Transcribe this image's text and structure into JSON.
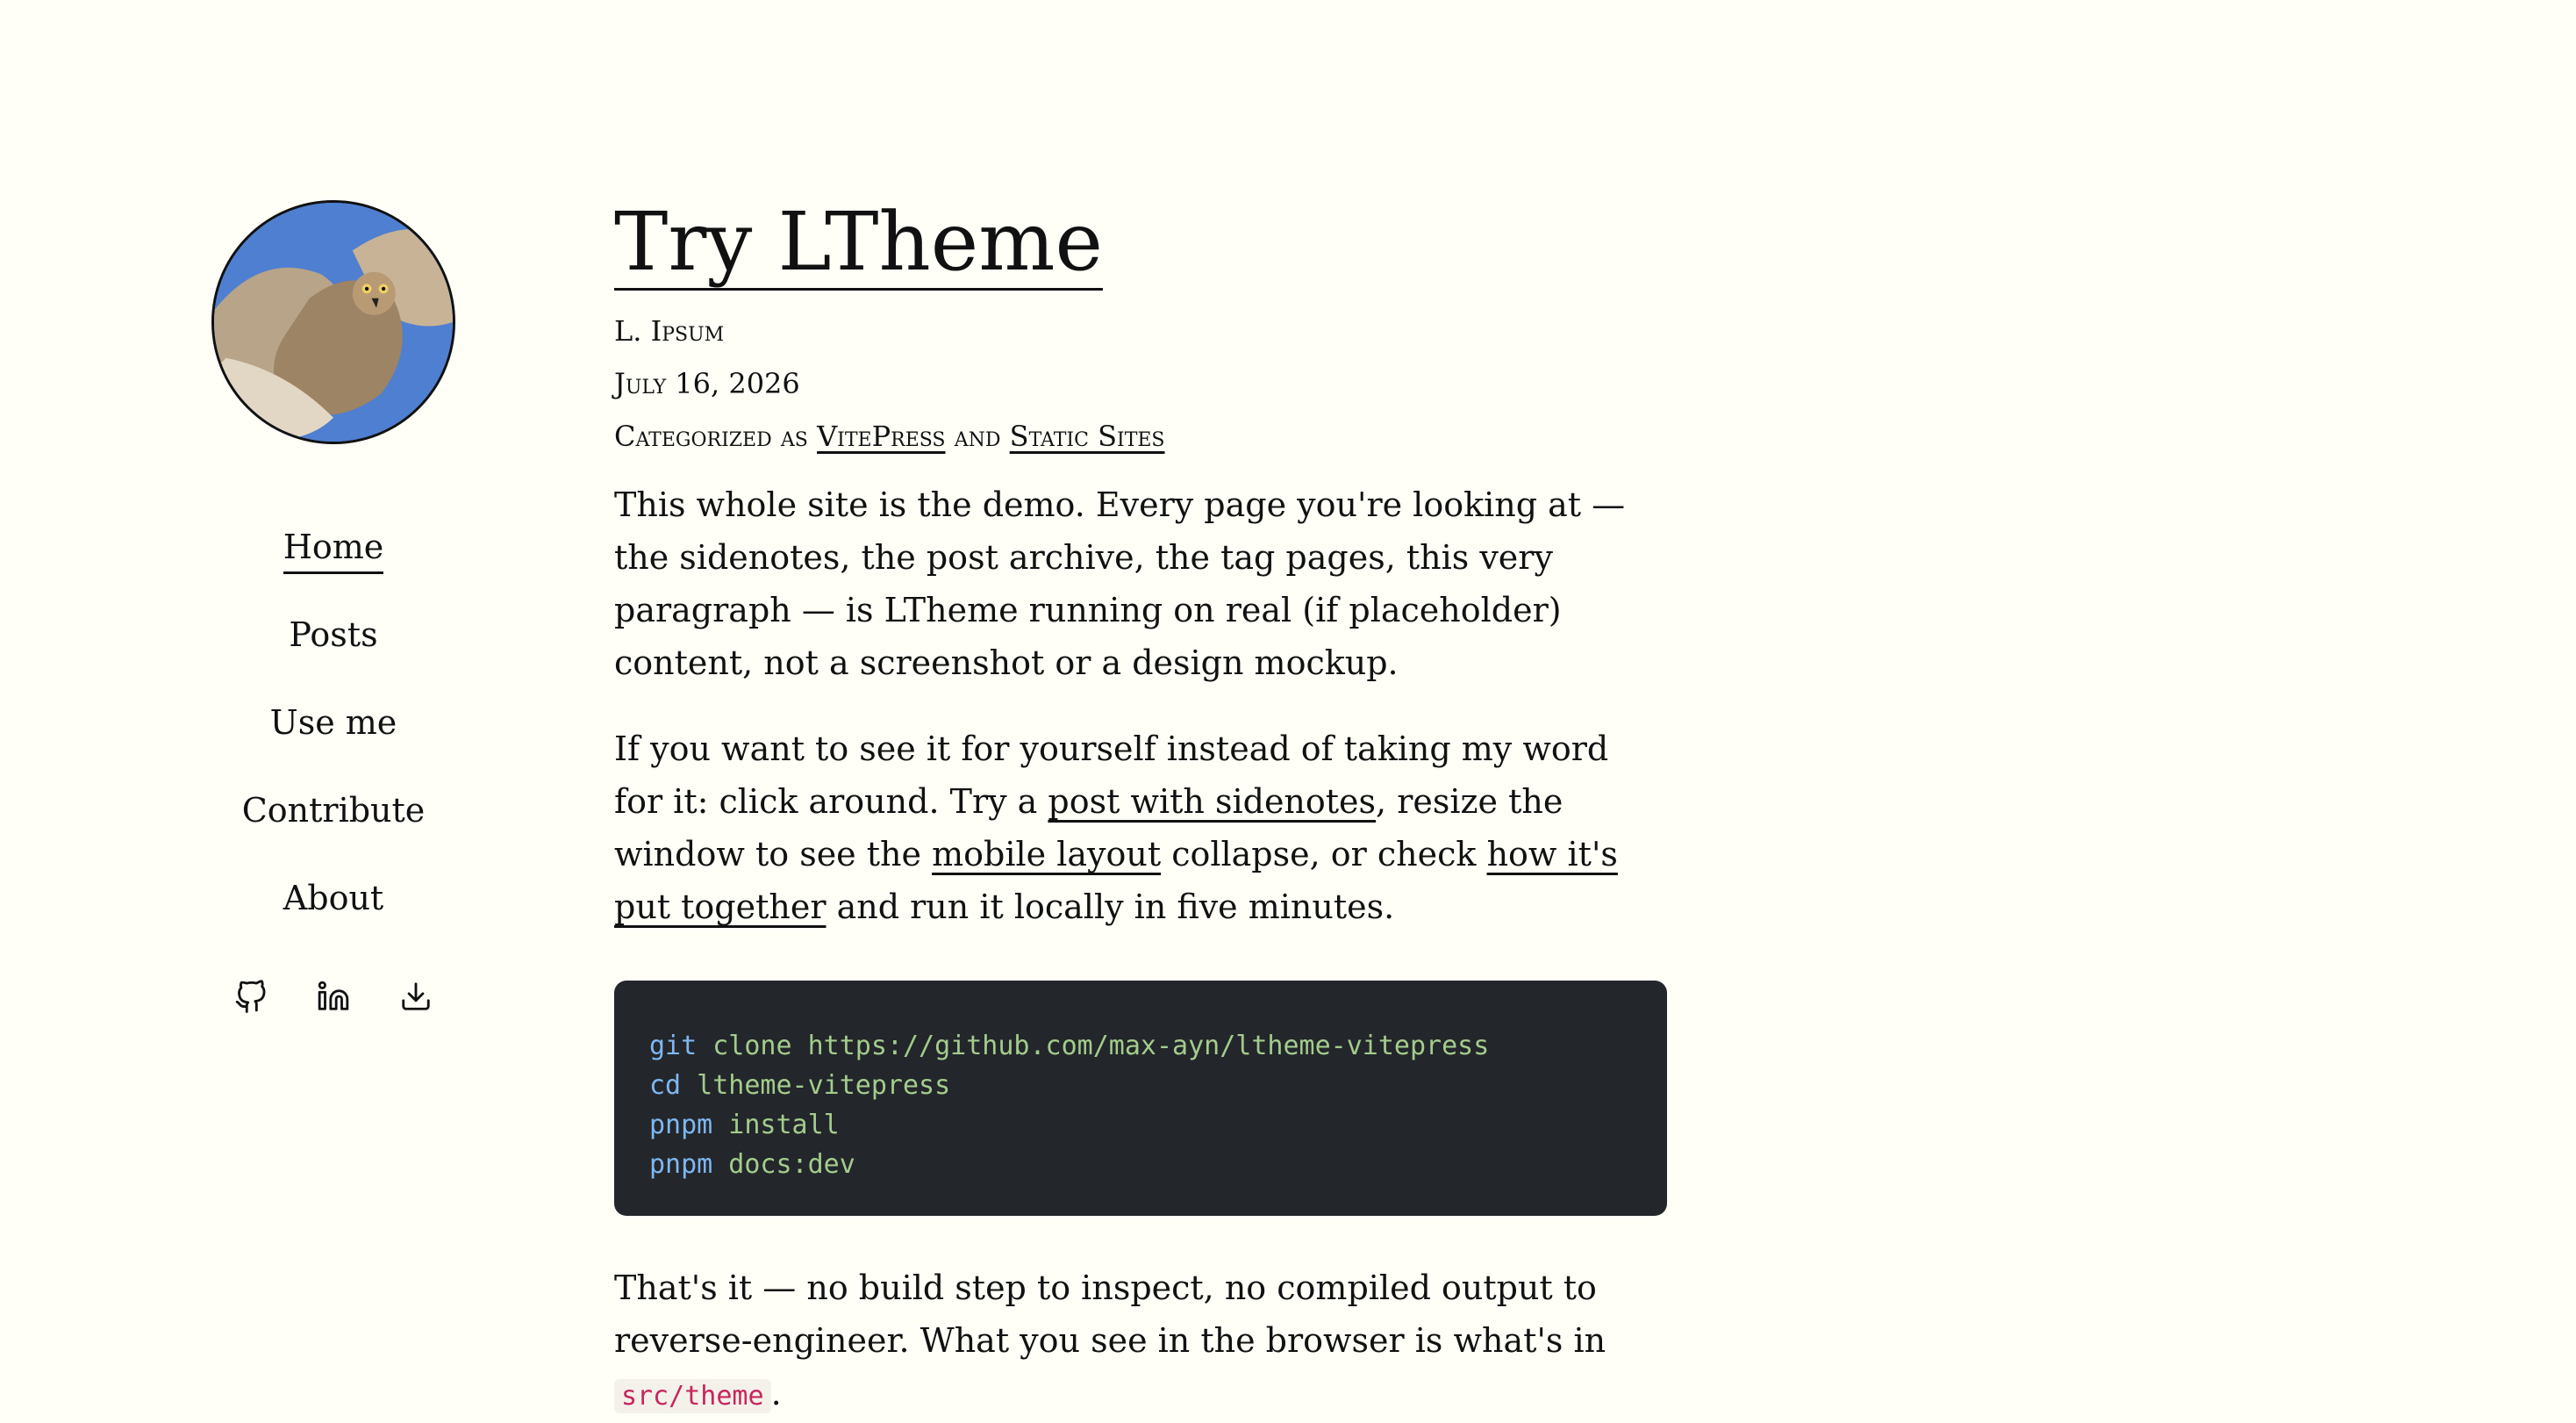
{
  "sidebar": {
    "nav": [
      "Home",
      "Posts",
      "Use me",
      "Contribute",
      "About"
    ],
    "social_icons": [
      "github-icon",
      "linkedin-icon",
      "download-icon"
    ]
  },
  "post": {
    "title": "Try LTheme",
    "author": "L. Ipsum",
    "date": "July 16, 2026",
    "categorized_as": "Categorized as",
    "and": "and",
    "tags": [
      "VitePress",
      "Static Sites"
    ],
    "p1": "This whole site is the demo. Every page you're looking at — the sidenotes, the post archive, the tag pages, this very paragraph — is LTheme running on real (if placeholder) content, not a screenshot or a design mockup.",
    "p2_a": "If you want to see it for yourself instead of taking my word for it: click around. Try a",
    "p2_link1": "post with sidenotes",
    "p2_b": ", resize the window to see the",
    "p2_link2": "mobile layout",
    "p2_c": "collapse, or check",
    "p2_link3": "how it's put together",
    "p2_d": "and run it locally in five minutes.",
    "code": [
      {
        "cmd": "git",
        "args": " clone https://github.com/max-ayn/ltheme-vitepress"
      },
      {
        "cmd": "cd",
        "args": " ltheme-vitepress"
      },
      {
        "cmd": "pnpm",
        "args": " install"
      },
      {
        "cmd": "pnpm",
        "args": " docs:dev"
      }
    ],
    "p3_a": "That's it — no build step to inspect, no compiled output to reverse-engineer. What you see in the browser is what's in",
    "p3_code": "src/theme",
    "p3_b": "."
  },
  "colors": {
    "background": "#fffff8",
    "code_bg": "#23262b",
    "code_cmd": "#7fb7f0",
    "code_arg": "#a3cc8c",
    "inline_code": "#c8255e"
  }
}
